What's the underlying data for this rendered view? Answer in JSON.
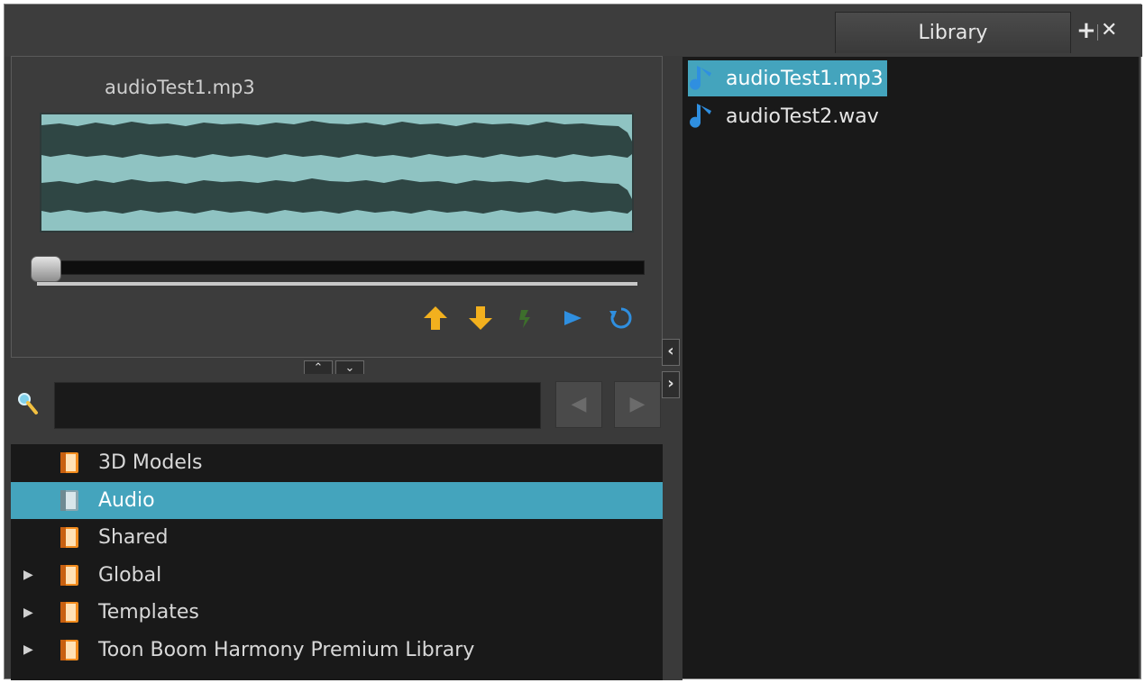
{
  "panel": {
    "tab_label": "Library",
    "add_glyph": "+",
    "close_glyph": "✕"
  },
  "preview": {
    "title": "audioTest1.mp3",
    "controls": [
      "arrow-up-icon",
      "arrow-down-icon",
      "refresh-icon",
      "play-icon",
      "loop-icon"
    ],
    "colors": {
      "wave_bg": "#8fc3c2",
      "wave_fg": "#2f4644",
      "accent": "#f2b01e",
      "play": "#2f8fe0"
    }
  },
  "splitter": {
    "up_glyph": "⌃",
    "down_glyph": "⌄"
  },
  "search": {
    "value": "",
    "placeholder": "",
    "back_glyph": "◀",
    "forward_glyph": "▶"
  },
  "tree": {
    "items": [
      {
        "label": "3D Models",
        "expandable": false,
        "selected": false
      },
      {
        "label": "Audio",
        "expandable": false,
        "selected": true
      },
      {
        "label": "Shared",
        "expandable": false,
        "selected": false
      },
      {
        "label": "Global",
        "expandable": true,
        "selected": false
      },
      {
        "label": "Templates",
        "expandable": true,
        "selected": false
      },
      {
        "label": "Toon Boom Harmony Premium Library",
        "expandable": true,
        "selected": false
      }
    ],
    "expand_glyph": "▶"
  },
  "collapse": {
    "left_glyph": "‹",
    "right_glyph": "›"
  },
  "files": [
    {
      "name": "audioTest1.mp3",
      "selected": true
    },
    {
      "name": "audioTest2.wav",
      "selected": false
    }
  ]
}
